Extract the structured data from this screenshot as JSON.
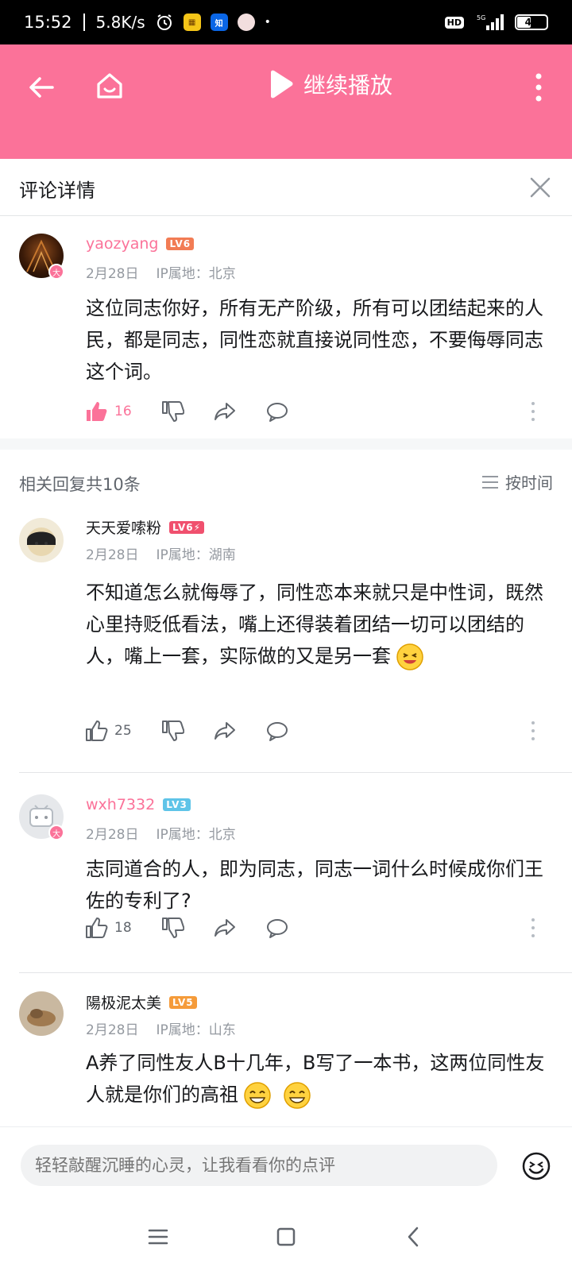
{
  "status_bar": {
    "time": "15:52",
    "speed": "5.8K/s",
    "hd": "HD",
    "net": "5G",
    "battery": "45",
    "battery_level": 0.45
  },
  "header": {
    "play_label": "继续播放",
    "accent": "#fb7299"
  },
  "detail": {
    "title": "评论详情"
  },
  "main_comment": {
    "username": "yaozyang",
    "level": "LV6",
    "date": "2月28日",
    "ip": "IP属地：北京",
    "text": "这位同志你好，所有无产阶级，所有可以团结起来的人民，都是同志，同性恋就直接说同性恋，不要侮辱同志这个词。",
    "likes": "16"
  },
  "replies_header": {
    "count_label": "相关回复共10条",
    "sort_label": "按时间"
  },
  "replies": [
    {
      "username": "天天爱嗦粉",
      "level": "LV6⚡",
      "date": "2月28日",
      "ip": "IP属地：湖南",
      "text": "不知道怎么就侮辱了，同性恋本来就只是中性词，既然心里持贬低看法，嘴上还得装着团结一切可以团结的人，嘴上一套，实际做的又是另一套",
      "likes": "25"
    },
    {
      "username": "wxh7332",
      "level": "LV3",
      "date": "2月28日",
      "ip": "IP属地：北京",
      "text": "志同道合的人，即为同志，同志一词什么时候成你们王佐的专利了?",
      "likes": "18"
    },
    {
      "username": "陽极泥太美",
      "level": "LV5",
      "date": "2月28日",
      "ip": "IP属地：山东",
      "text": "A养了同性友人B十几年，B写了一本书，这两位同性友人就是你们的高祖"
    }
  ],
  "input": {
    "placeholder": "轻轻敲醒沉睡的心灵，让我看看你的点评"
  }
}
